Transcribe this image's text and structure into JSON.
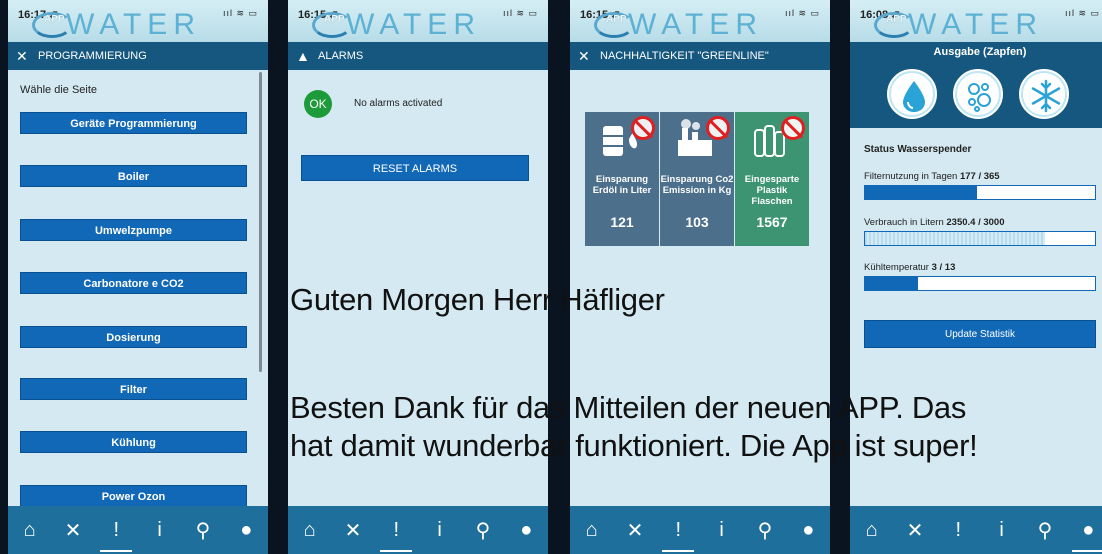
{
  "app": {
    "logo_small": "APP",
    "logo_main": "WATER"
  },
  "status_icons": "ııl ≋ ▭",
  "nav_icons": {
    "home": "⌂",
    "tools": "✕",
    "alert": "!",
    "info": "i",
    "search": "⚲",
    "user": "●"
  },
  "phone1": {
    "time": "16:17 ⬈",
    "header": "PROGRAMMIERUNG",
    "label": "Wähle die Seite",
    "buttons": [
      "Geräte Programmierung",
      "Boiler",
      "Umwelzpumpe",
      "Carbonatore e CO2",
      "Dosierung",
      "Filter",
      "Kühlung",
      "Power Ozon"
    ]
  },
  "phone2": {
    "time": "16:15 ⬈",
    "header": "ALARMS",
    "ok": "OK",
    "alarm_text": "No alarms activated",
    "reset": "RESET ALARMS"
  },
  "phone3": {
    "time": "16:15 ⬈",
    "header": "NACHHALTIGKEIT \"GREENLINE\"",
    "tiles": [
      {
        "label": "Einsparung Erdöl in Liter",
        "value": "121",
        "color": "#4c6f8c"
      },
      {
        "label": "Einsparung Co2 Emission in Kg",
        "value": "103",
        "color": "#4c6f8c"
      },
      {
        "label": "Eingesparte Plastik Flaschen",
        "value": "1567",
        "color": "#3d9473"
      }
    ]
  },
  "phone4": {
    "time": "16:08 ⬈",
    "title": "Ausgabe (Zapfen)",
    "status_title": "Status Wasserspender",
    "stats": [
      {
        "label": "Filternutzung in Tagen",
        "value": "177 / 365",
        "ratio": 0.485,
        "style": "solid"
      },
      {
        "label": "Verbrauch in Litern",
        "value": "2350.4 / 3000",
        "ratio": 0.783,
        "style": "light"
      },
      {
        "label": "Kühltemperatur",
        "value": "3 / 13",
        "ratio": 0.23,
        "style": "solid"
      }
    ],
    "update": "Update Statistik"
  },
  "caption": {
    "line1": "Guten Morgen Herr Häfliger",
    "line2": "Besten Dank für das Mitteilen der neuen APP. Das",
    "line3": "hat damit wunderbar funktioniert. Die App ist super!"
  }
}
